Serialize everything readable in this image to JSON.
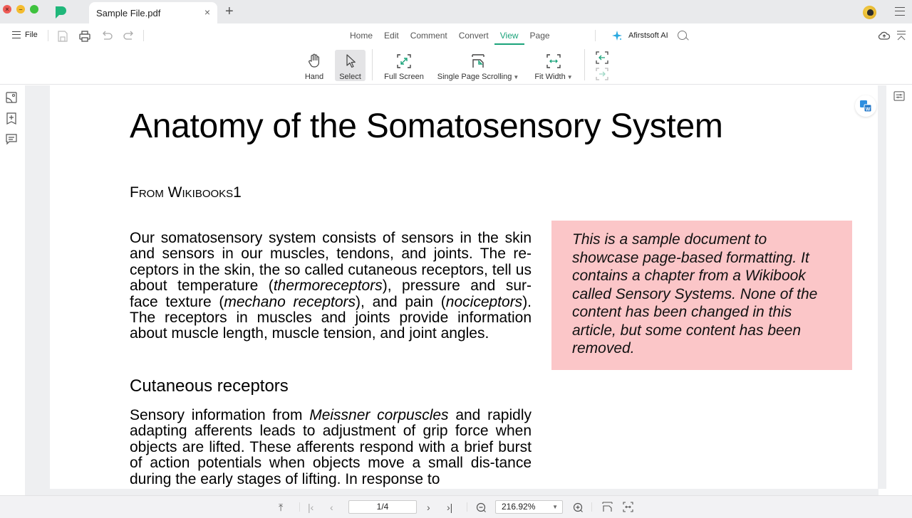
{
  "window": {
    "tab_title": "Sample File.pdf",
    "tab_close_glyph": "×",
    "new_tab_glyph": "+"
  },
  "toolbar": {
    "file_label": "File",
    "menu_tabs": [
      {
        "label": "Home",
        "active": false
      },
      {
        "label": "Edit",
        "active": false
      },
      {
        "label": "Comment",
        "active": false
      },
      {
        "label": "Convert",
        "active": false
      },
      {
        "label": "View",
        "active": true
      },
      {
        "label": "Page",
        "active": false
      }
    ],
    "ai_label": "Afirstsoft AI",
    "accent_color": "#1aa37a",
    "tools": [
      {
        "label": "Hand",
        "icon": "hand-icon",
        "selected": false
      },
      {
        "label": "Select",
        "icon": "cursor-icon",
        "selected": true
      },
      {
        "label": "Full Screen",
        "icon": "fullscreen-icon",
        "selected": false
      },
      {
        "label": "Single Page Scrolling",
        "icon": "single-page-icon",
        "selected": false,
        "dropdown": true
      },
      {
        "label": "Fit Width",
        "icon": "fit-width-icon",
        "selected": false,
        "dropdown": true
      }
    ]
  },
  "document": {
    "title": "Anatomy of the Somatosensory System",
    "subtitle": "From Wikibooks1",
    "para1": [
      {
        "t": "Our somatosensory system consists of sensors in the skin and sensors in our muscles, tendons, and joints. The re-ceptors in the skin, the so called cutaneous receptors, tell us about temperature (",
        "i": false
      },
      {
        "t": "thermoreceptors",
        "i": true
      },
      {
        "t": "), pressure and sur- face texture (",
        "i": false
      },
      {
        "t": "mechano receptors",
        "i": true
      },
      {
        "t": "), and pain (",
        "i": false
      },
      {
        "t": "nociceptors",
        "i": true
      },
      {
        "t": "). The receptors in muscles and joints provide information about muscle length, muscle tension, and joint angles.",
        "i": false
      }
    ],
    "heading2": "Cutaneous receptors",
    "para2": [
      {
        "t": "Sensory information from ",
        "i": false
      },
      {
        "t": "Meissner corpuscles",
        "i": true
      },
      {
        "t": " and rapidly adapting afferents leads to adjustment of grip force when objects are lifted. These afferents respond with a brief burst of action potentials when objects move a small dis-tance during the early stages of lifting. In response to",
        "i": false
      }
    ],
    "callout": "This is a sample document to showcase page-based formatting. It contains a chapter from a Wikibook called Sensory Systems. None of the content has been changed in this article, but some content has been removed.",
    "callout_color": "#fbc6c8"
  },
  "bottombar": {
    "page_value": "1/4",
    "zoom_value": "216.92%"
  }
}
